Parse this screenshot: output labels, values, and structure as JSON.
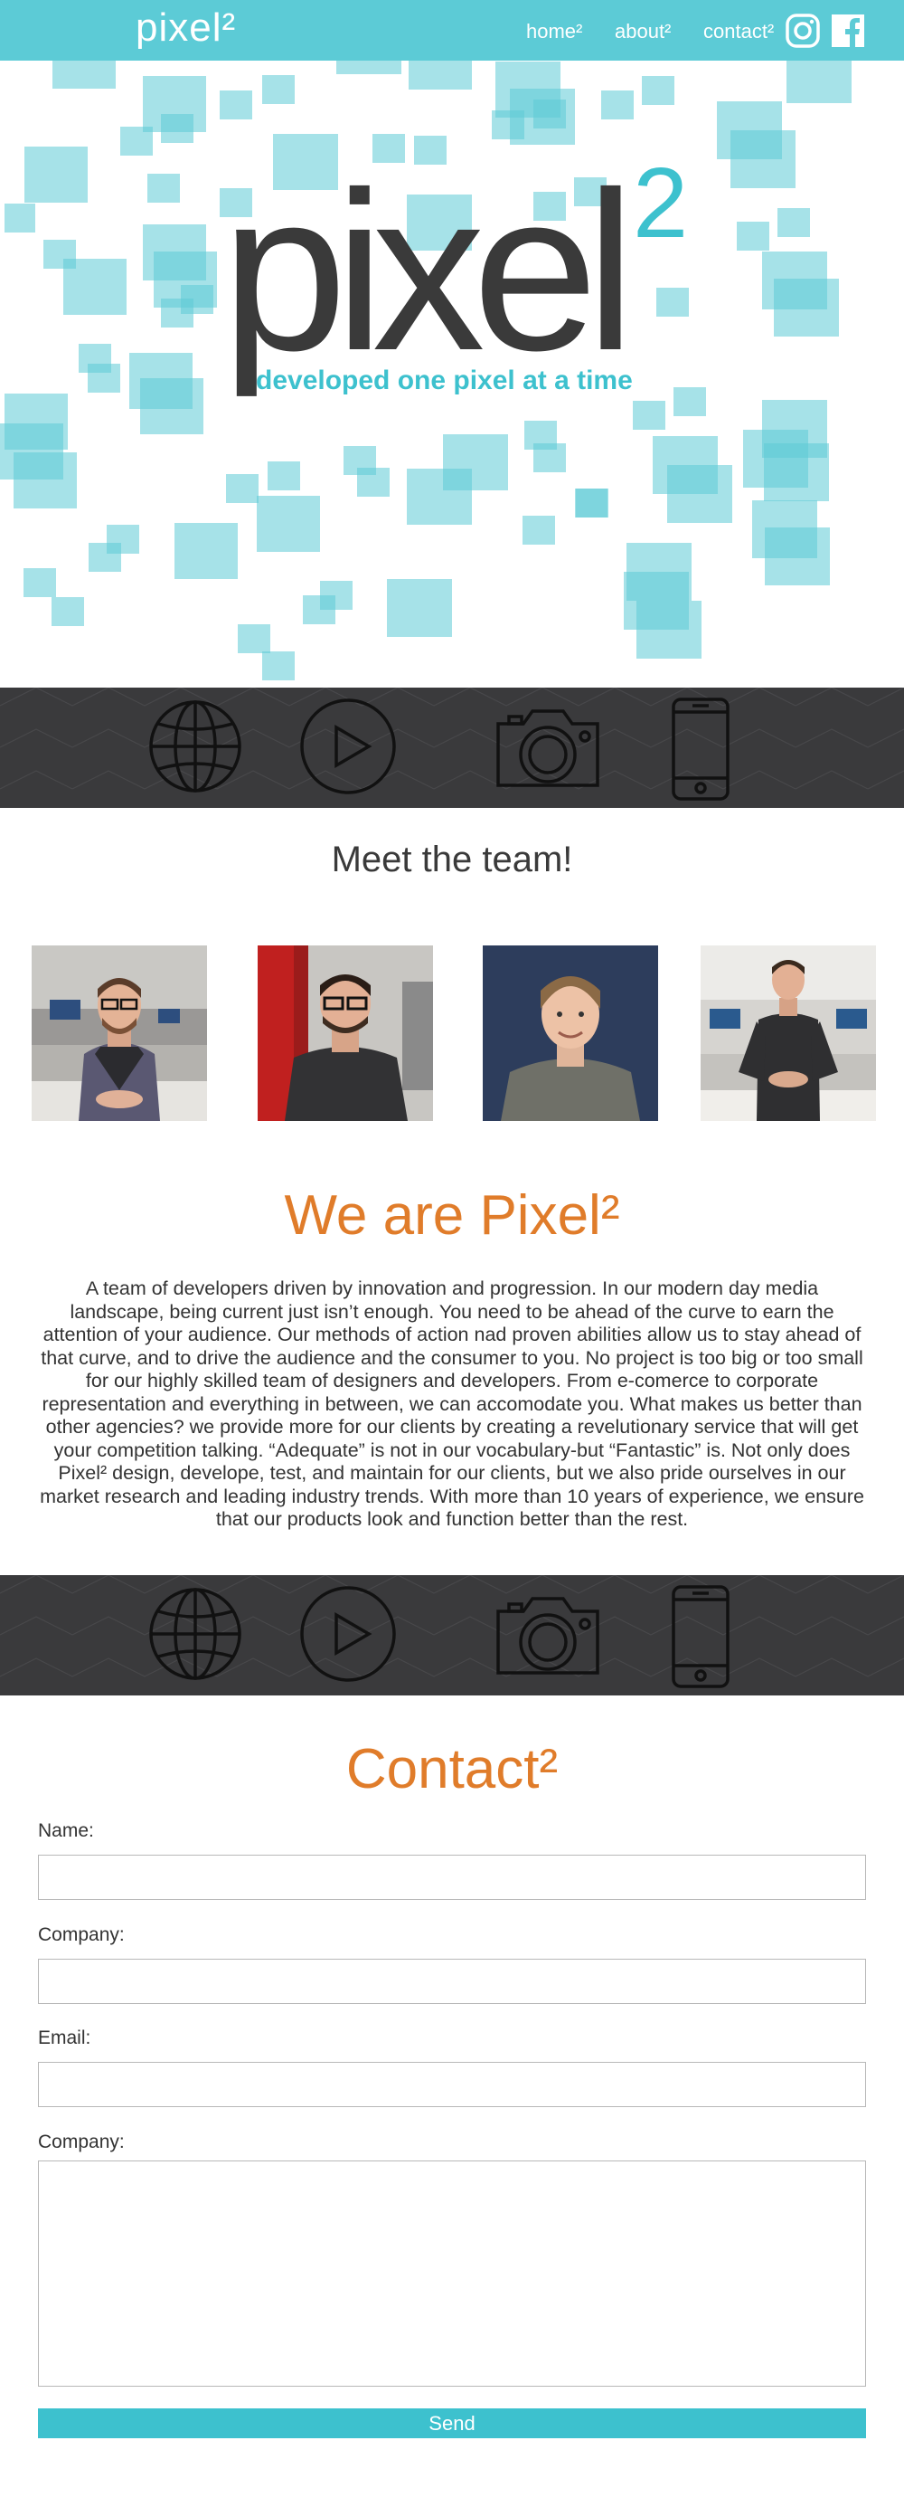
{
  "header": {
    "logo": "pixel²",
    "nav": {
      "home": "home²",
      "about": "about²",
      "contact": "contact²"
    },
    "social_icons": [
      "instagram-icon",
      "facebook-icon"
    ]
  },
  "hero": {
    "word": "pixel",
    "superscript": "2",
    "tagline": "developed one pixel at a time"
  },
  "iconbar_icons": [
    "globe-icon",
    "play-icon",
    "camera-icon",
    "phone-icon"
  ],
  "team": {
    "title": "Meet the team!",
    "members": [
      "team-photo-1",
      "team-photo-2",
      "team-photo-3",
      "team-photo-4"
    ]
  },
  "about": {
    "title": "We are Pixel²",
    "text": "A team of developers driven by innovation and progression. In our modern day media landscape, being current just isn’t enough. You need to be ahead of the curve to earn the attention of your audience. Our methods of action nad proven abilities allow us to stay ahead of that curve, and to drive the audience and the consumer to you. No project is too big or too small for our highly skilled team of designers and developers. From e-comerce to corporate representation and everything in between, we can accomodate you. What makes us better than other agencies? we provide more for our clients by creating a revelutionary service that will get your competition talking. “Adequate” is not in our vocabulary-but “Fantastic” is. Not only does Pixel² design, develope, test, and maintain for our clients, but we also pride ourselves in our market research and leading industry trends. With more than 10 years of experience, we ensure that our products look and function better than the rest."
  },
  "contact": {
    "title": "Contact²",
    "fields": {
      "name": {
        "label": "Name:",
        "value": ""
      },
      "company": {
        "label": "Company:",
        "value": ""
      },
      "email": {
        "label": "Email:",
        "value": ""
      },
      "message": {
        "label": "Company:",
        "value": ""
      }
    },
    "send_label": "Send"
  },
  "colors": {
    "brand": "#5ccbd6",
    "accent": "#e07c2a",
    "dark": "#3a3a3c"
  }
}
